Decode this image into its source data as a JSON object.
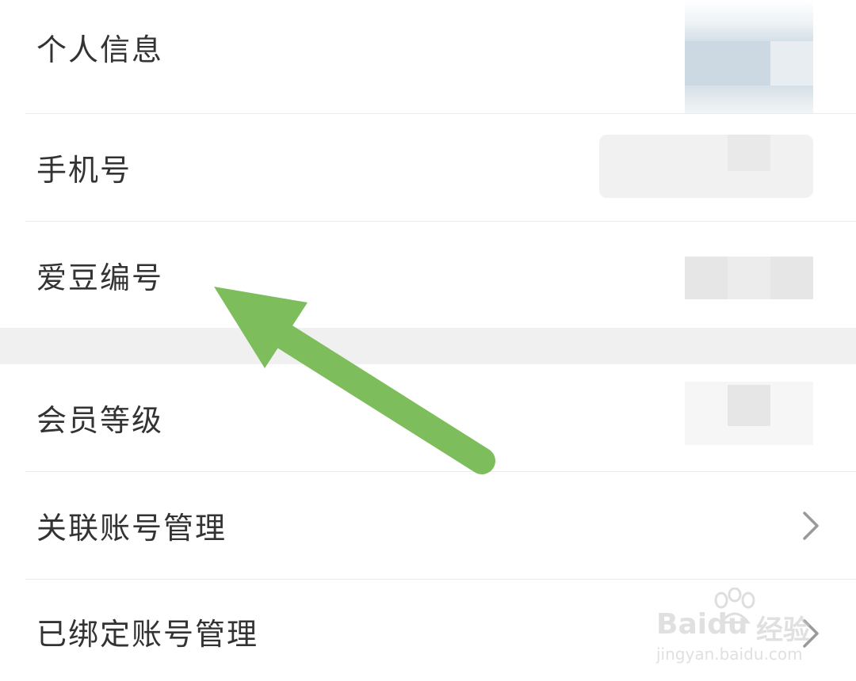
{
  "rows": [
    {
      "label": "个人信息"
    },
    {
      "label": "手机号"
    },
    {
      "label": "爱豆编号"
    },
    {
      "label": "会员等级"
    },
    {
      "label": "关联账号管理"
    },
    {
      "label": "已绑定账号管理"
    }
  ],
  "watermark": {
    "brand": "Baidu",
    "cn": "经验",
    "url": "jingyan.baidu.com"
  },
  "colors": {
    "arrow": "#7dbd5c",
    "text": "#333333",
    "divider": "#ebebeb",
    "section_gap": "#f0f0f0"
  }
}
